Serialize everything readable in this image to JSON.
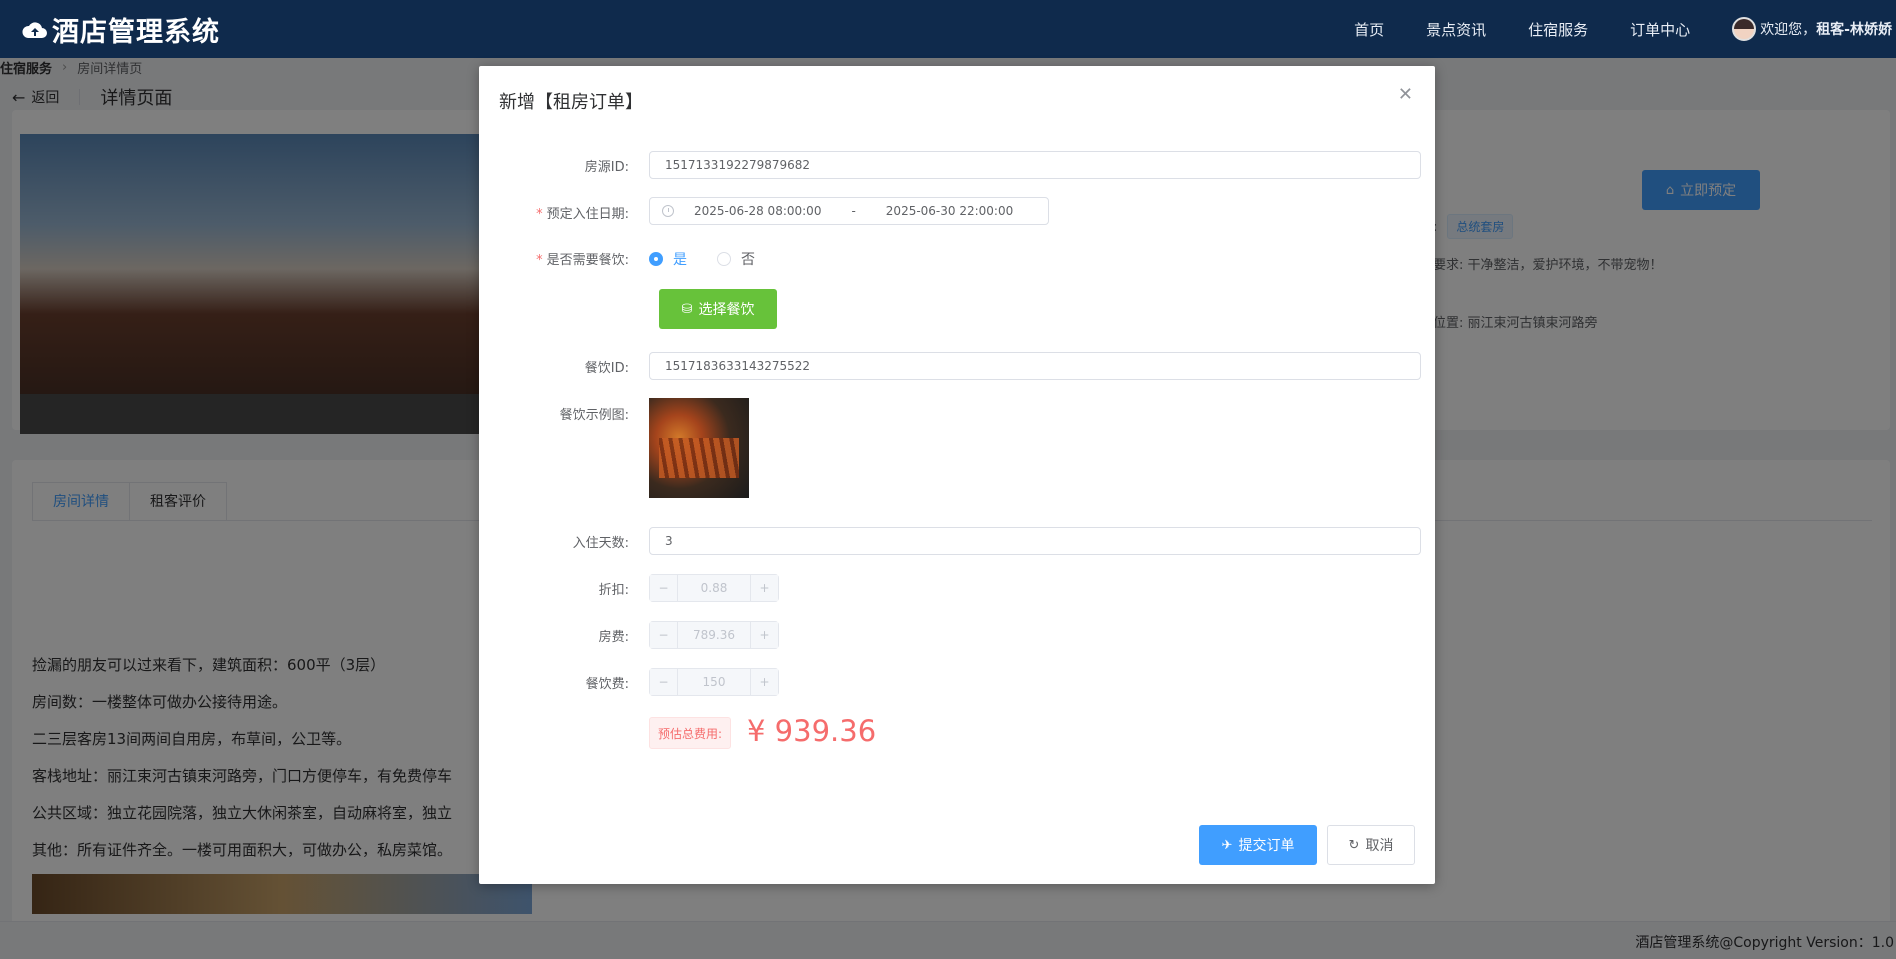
{
  "app": {
    "title": "酒店管理系统"
  },
  "nav": {
    "items": [
      "首页",
      "景点资讯",
      "住宿服务",
      "订单中心"
    ],
    "user_prefix": "欢迎您，",
    "user_name": "租客-林娇娇"
  },
  "breadcrumb": [
    "住宿服务",
    "房间详情页"
  ],
  "page_header": {
    "back_label": "返回",
    "title": "详情页面"
  },
  "room": {
    "book_button": "立即预定",
    "type_tag": "总统套房",
    "requirement": "生要求: 干净整洁，爱护环境，不带宠物！",
    "location": "体位置: 丽江束河古镇束河路旁"
  },
  "tabs": [
    "房间详情",
    "租客评价"
  ],
  "description": [
    "捡漏的朋友可以过来看下，建筑面积：600平（3层）",
    "房间数：一楼整体可做办公接待用途。",
    "二三层客房13间两间自用房，布草间，公卫等。",
    "客栈地址：丽江束河古镇束河路旁，门口方便停车，有免费停车",
    "公共区域：独立花园院落，独立大休闲茶室，自动麻将室，独立",
    "其他：所有证件齐全。一楼可用面积大，可做办公，私房菜馆。"
  ],
  "footer": "酒店管理系统@Copyright Version：1.0",
  "dialog": {
    "title": "新增【租房订单】",
    "fields": {
      "room_id": {
        "label": "房源ID:",
        "value": "1517133192279879682"
      },
      "checkin": {
        "label": "预定入住日期:",
        "start": "2025-06-28 08:00:00",
        "sep": "-",
        "end": "2025-06-30 22:00:00"
      },
      "need_food": {
        "label": "是否需要餐饮:",
        "yes": "是",
        "no": "否",
        "selected": "是"
      },
      "choose_food_button": "选择餐饮",
      "food_id": {
        "label": "餐饮ID:",
        "value": "1517183633143275522"
      },
      "food_image": {
        "label": "餐饮示例图:"
      },
      "days": {
        "label": "入住天数:",
        "value": "3"
      },
      "discount": {
        "label": "折扣:",
        "value": "0.88"
      },
      "room_fee": {
        "label": "房费:",
        "value": "789.36"
      },
      "food_fee": {
        "label": "餐饮费:",
        "value": "150"
      },
      "total": {
        "label": "预估总费用:",
        "value": "¥ 939.36"
      }
    },
    "submit_button": "提交订单",
    "cancel_button": "取消"
  },
  "colors": {
    "header_bg": "#0f2a4c",
    "primary": "#409eff",
    "success": "#67c23a",
    "danger": "#f56c6c"
  }
}
